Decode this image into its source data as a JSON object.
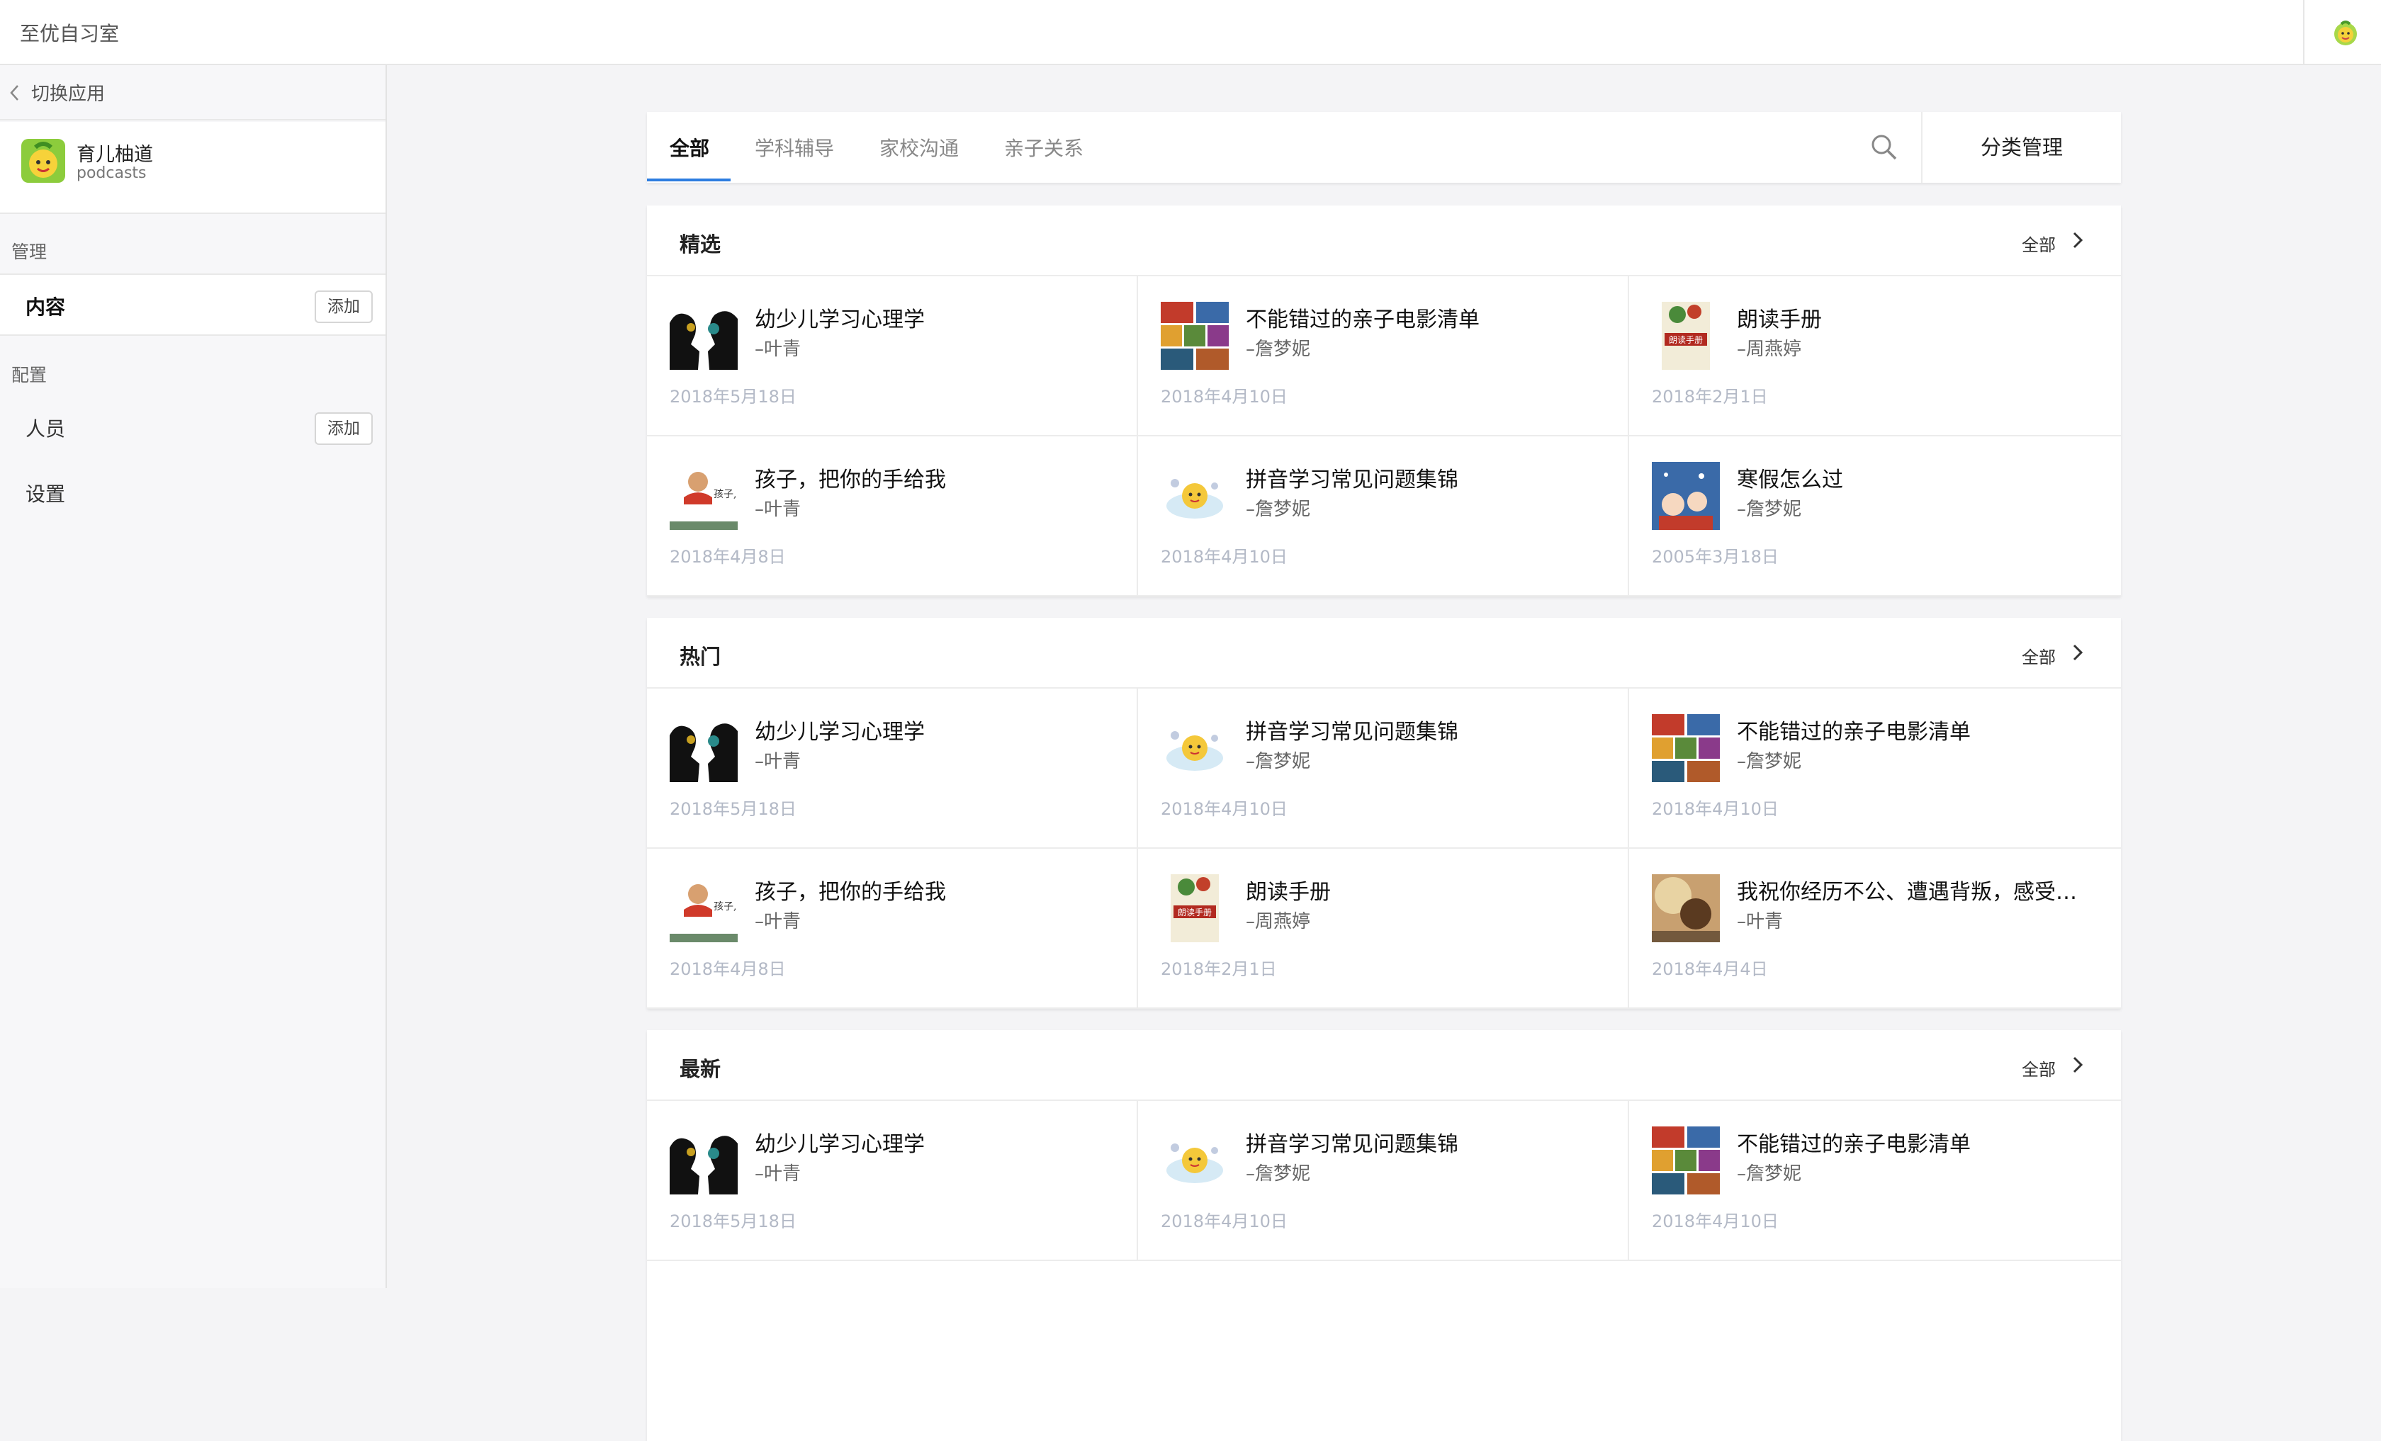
{
  "header": {
    "app_title": "至优自习室"
  },
  "sidebar": {
    "switch_label": "切换应用",
    "app_name": "育儿柚道",
    "app_sub": "podcasts",
    "manage_label": "管理",
    "content_label": "内容",
    "add_label": "添加",
    "config_label": "配置",
    "people_label": "人员",
    "settings_label": "设置"
  },
  "tabs": [
    "全部",
    "学科辅导",
    "家校沟通",
    "亲子关系"
  ],
  "manage_label": "分类管理",
  "sections": [
    {
      "title": "精选",
      "all_label": "全部",
      "items": [
        {
          "title": "幼少儿学习心理学",
          "author": "–叶青",
          "date": "2018年5月18日",
          "thumb": "silhouette"
        },
        {
          "title": "不能错过的亲子电影清单",
          "author": "–詹梦妮",
          "date": "2018年4月10日",
          "thumb": "collage"
        },
        {
          "title": "朗读手册",
          "author": "–周燕婷",
          "date": "2018年2月1日",
          "thumb": "book"
        },
        {
          "title": "孩子，把你的手给我",
          "author": "–叶青",
          "date": "2018年4月8日",
          "thumb": "handbook"
        },
        {
          "title": "拼音学习常见问题集锦",
          "author": "–詹梦妮",
          "date": "2018年4月10日",
          "thumb": "mascot"
        },
        {
          "title": "寒假怎么过",
          "author": "–詹梦妮",
          "date": "2005年3月18日",
          "thumb": "winter"
        }
      ]
    },
    {
      "title": "热门",
      "all_label": "全部",
      "items": [
        {
          "title": "幼少儿学习心理学",
          "author": "–叶青",
          "date": "2018年5月18日",
          "thumb": "silhouette"
        },
        {
          "title": "拼音学习常见问题集锦",
          "author": "–詹梦妮",
          "date": "2018年4月10日",
          "thumb": "mascot"
        },
        {
          "title": "不能错过的亲子电影清单",
          "author": "–詹梦妮",
          "date": "2018年4月10日",
          "thumb": "collage"
        },
        {
          "title": "孩子，把你的手给我",
          "author": "–叶青",
          "date": "2018年4月8日",
          "thumb": "handbook"
        },
        {
          "title": "朗读手册",
          "author": "–周燕婷",
          "date": "2018年2月1日",
          "thumb": "book"
        },
        {
          "title": "我祝你经历不公、遭遇背叛，感受…",
          "author": "–叶青",
          "date": "2018年4月4日",
          "thumb": "photo"
        }
      ]
    },
    {
      "title": "最新",
      "all_label": "全部",
      "items": [
        {
          "title": "幼少儿学习心理学",
          "author": "–叶青",
          "date": "2018年5月18日",
          "thumb": "silhouette"
        },
        {
          "title": "拼音学习常见问题集锦",
          "author": "–詹梦妮",
          "date": "2018年4月10日",
          "thumb": "mascot"
        },
        {
          "title": "不能错过的亲子电影清单",
          "author": "–詹梦妮",
          "date": "2018年4月10日",
          "thumb": "collage"
        }
      ]
    }
  ],
  "colors": {
    "accent": "#2d7de0",
    "date": "#b3b9c6",
    "background": "#f4f4f6"
  }
}
